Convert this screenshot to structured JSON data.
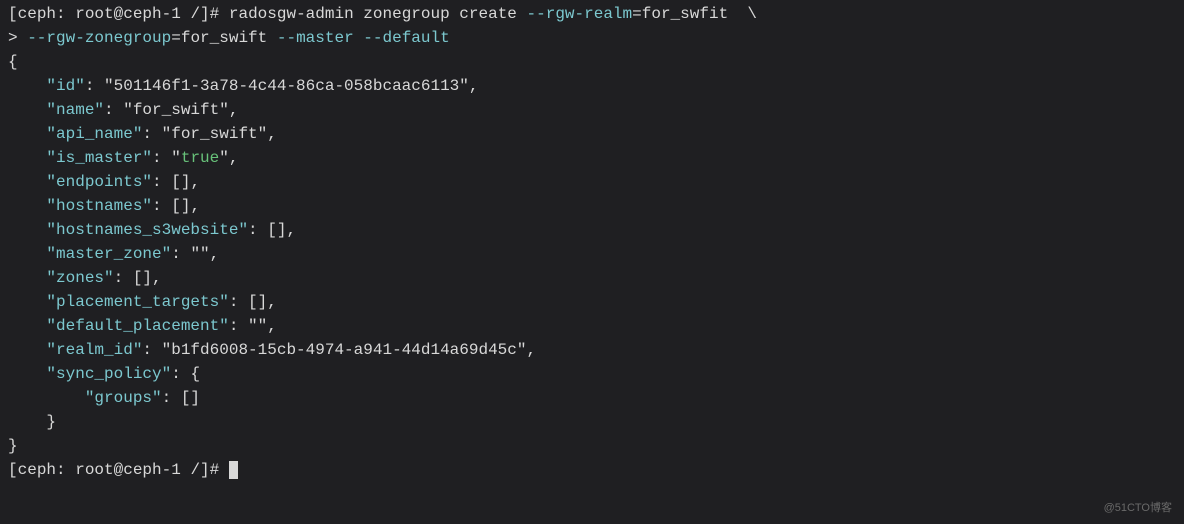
{
  "prompt": {
    "open": "[",
    "env": "ceph",
    "sep": ": ",
    "user": "root@ceph-1",
    "path": " /",
    "close": "]",
    "hash": "# "
  },
  "cmd": {
    "line1_cmd": "radosgw-admin zonegroup create ",
    "line1_flag1": "--rgw-realm",
    "line1_eq": "=",
    "line1_val1": "for_swfit",
    "line1_trail": "  \\",
    "cont_prompt": "> ",
    "line2_flag1": "--rgw-zonegroup",
    "line2_val1": "for_swift",
    "line2_sp": " ",
    "line2_flag2": "--master",
    "line2_flag3": "--default"
  },
  "json": {
    "open": "{",
    "close": "}",
    "kv": {
      "id_k": "\"id\"",
      "id_v": "\"501146f1-3a78-4c44-86ca-058bcaac6113\"",
      "name_k": "\"name\"",
      "name_v": "\"for_swift\"",
      "api_name_k": "\"api_name\"",
      "api_name_v": "\"for_swift\"",
      "is_master_k": "\"is_master\"",
      "is_master_v": "\"true\"",
      "endpoints_k": "\"endpoints\"",
      "endpoints_v": "[]",
      "hostnames_k": "\"hostnames\"",
      "hostnames_v": "[]",
      "hostnames_s3_k": "\"hostnames_s3website\"",
      "hostnames_s3_v": "[]",
      "master_zone_k": "\"master_zone\"",
      "master_zone_v": "\"\"",
      "zones_k": "\"zones\"",
      "zones_v": "[]",
      "placement_targets_k": "\"placement_targets\"",
      "placement_targets_v": "[]",
      "default_placement_k": "\"default_placement\"",
      "default_placement_v": "\"\"",
      "realm_id_k": "\"realm_id\"",
      "realm_id_v": "\"b1fd6008-15cb-4974-a941-44d14a69d45c\"",
      "sync_policy_k": "\"sync_policy\"",
      "sync_policy_open": "{",
      "groups_k": "\"groups\"",
      "groups_v": "[]",
      "sync_policy_close": "}"
    },
    "colon": ": ",
    "comma": ","
  },
  "watermark": "@51CTO博客"
}
